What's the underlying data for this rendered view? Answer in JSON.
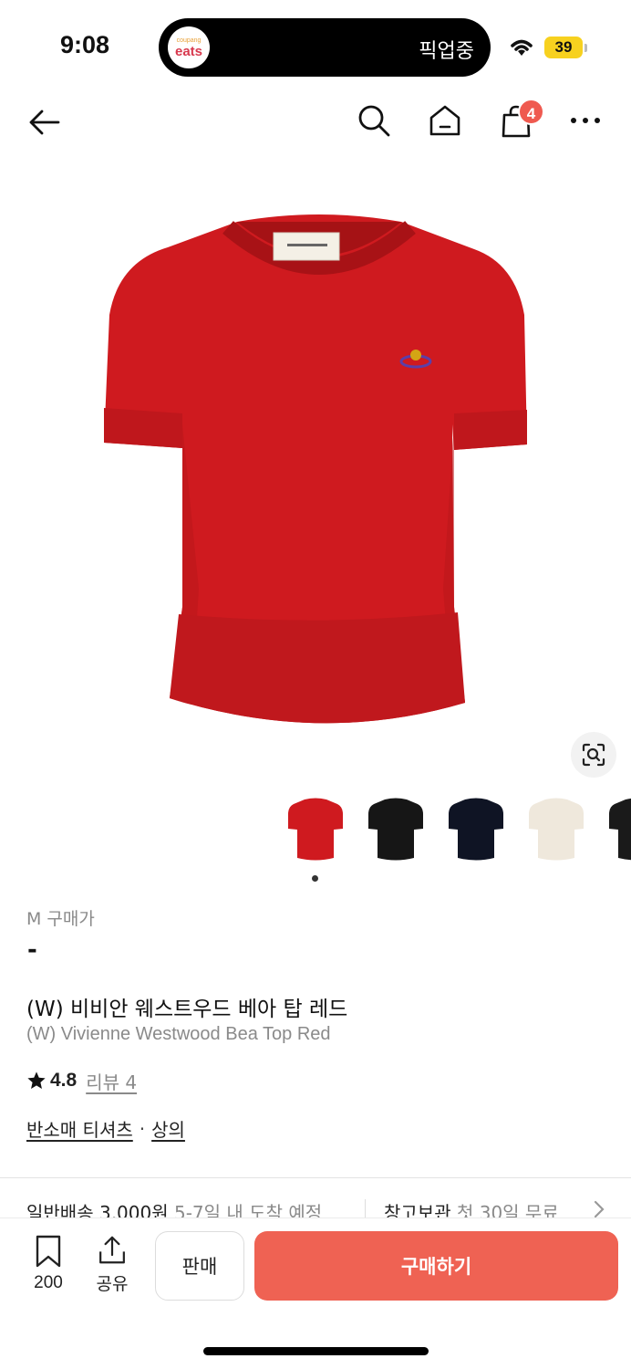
{
  "status_bar": {
    "time": "9:08",
    "live_activity": {
      "app_small": "coupang",
      "app_big": "eats",
      "text": "픽업중"
    },
    "battery": "39"
  },
  "header": {
    "icons": [
      "back-arrow-icon",
      "search-icon",
      "home-icon",
      "cart-icon",
      "more-icon"
    ],
    "cart_count": "4"
  },
  "product": {
    "image_color": "#cf1a1f",
    "thumbnails": [
      {
        "name": "red",
        "color": "#cf1a1f"
      },
      {
        "name": "black",
        "color": "#161616"
      },
      {
        "name": "navy",
        "color": "#0f1424"
      },
      {
        "name": "cream",
        "color": "#efe8dc"
      },
      {
        "name": "black-2",
        "color": "#1a1a1a"
      }
    ],
    "price_label": "M 구매가",
    "price_value": "-",
    "title_ko": "(W) 비비안 웨스트우드 베아 탑 레드",
    "title_en": "(W) Vivienne Westwood Bea Top Red",
    "rating": "4.8",
    "review_label": "리뷰 4",
    "categories": [
      "반소매 티셔츠",
      "상의"
    ],
    "category_separator": "·"
  },
  "shipping": {
    "standard_label": "일반배송",
    "standard_price": "3,000원",
    "standard_eta": "5-7일 내 도착 예정",
    "storage_label": "창고보관",
    "storage_note": "첫 30일 무료"
  },
  "bottom_bar": {
    "bookmark_count": "200",
    "share_label": "공유",
    "sell_label": "판매",
    "buy_label": "구매하기"
  },
  "colors": {
    "accent": "#ef6253",
    "badge": "#ef5a50",
    "battery": "#f7d11f"
  }
}
